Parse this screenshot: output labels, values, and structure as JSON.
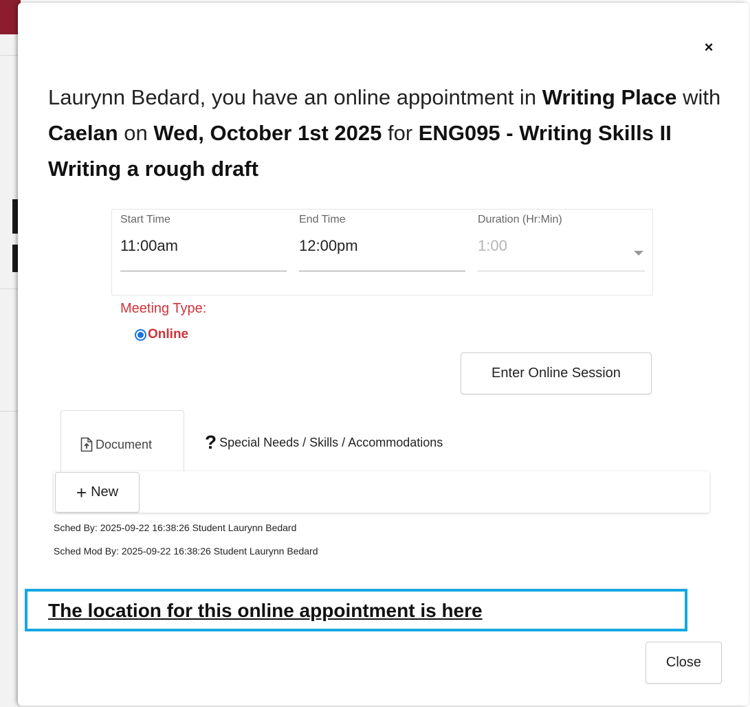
{
  "modal": {
    "headline": {
      "p1": "Laurynn Bedard, you have an online appointment in ",
      "location": "Writing Place",
      "p2": " with ",
      "tutor": "Caelan",
      "p3": " on ",
      "date": "Wed, October 1st 2025",
      "p4": " for ",
      "course": "ENG095 - Writing Skills II Writing a rough draft"
    },
    "time": {
      "start_label": "Start Time",
      "start_value": "11:00am",
      "end_label": "End Time",
      "end_value": "12:00pm",
      "duration_label": "Duration (Hr:Min)",
      "duration_value": "1:00"
    },
    "meeting_type": {
      "label": "Meeting Type:",
      "option": "Online"
    },
    "enter_session_button": "Enter Online Session",
    "tabs": [
      {
        "label": "Document",
        "icon": "file-upload-icon"
      },
      {
        "label": "Special Needs / Skills / Accommodations",
        "icon": "question-mark-icon"
      }
    ],
    "new_button": "New",
    "sched_by": "Sched By: 2025-09-22 16:38:26 Student Laurynn Bedard",
    "sched_mod_by": "Sched Mod By: 2025-09-22 16:38:26 Student Laurynn Bedard",
    "location_link": "The location for this online appointment is here",
    "close_button": "Close",
    "close_icon": "×"
  },
  "colors": {
    "accent_red": "#d0323a",
    "radio_blue": "#1a73e8",
    "highlight_blue": "#16a7e2"
  }
}
